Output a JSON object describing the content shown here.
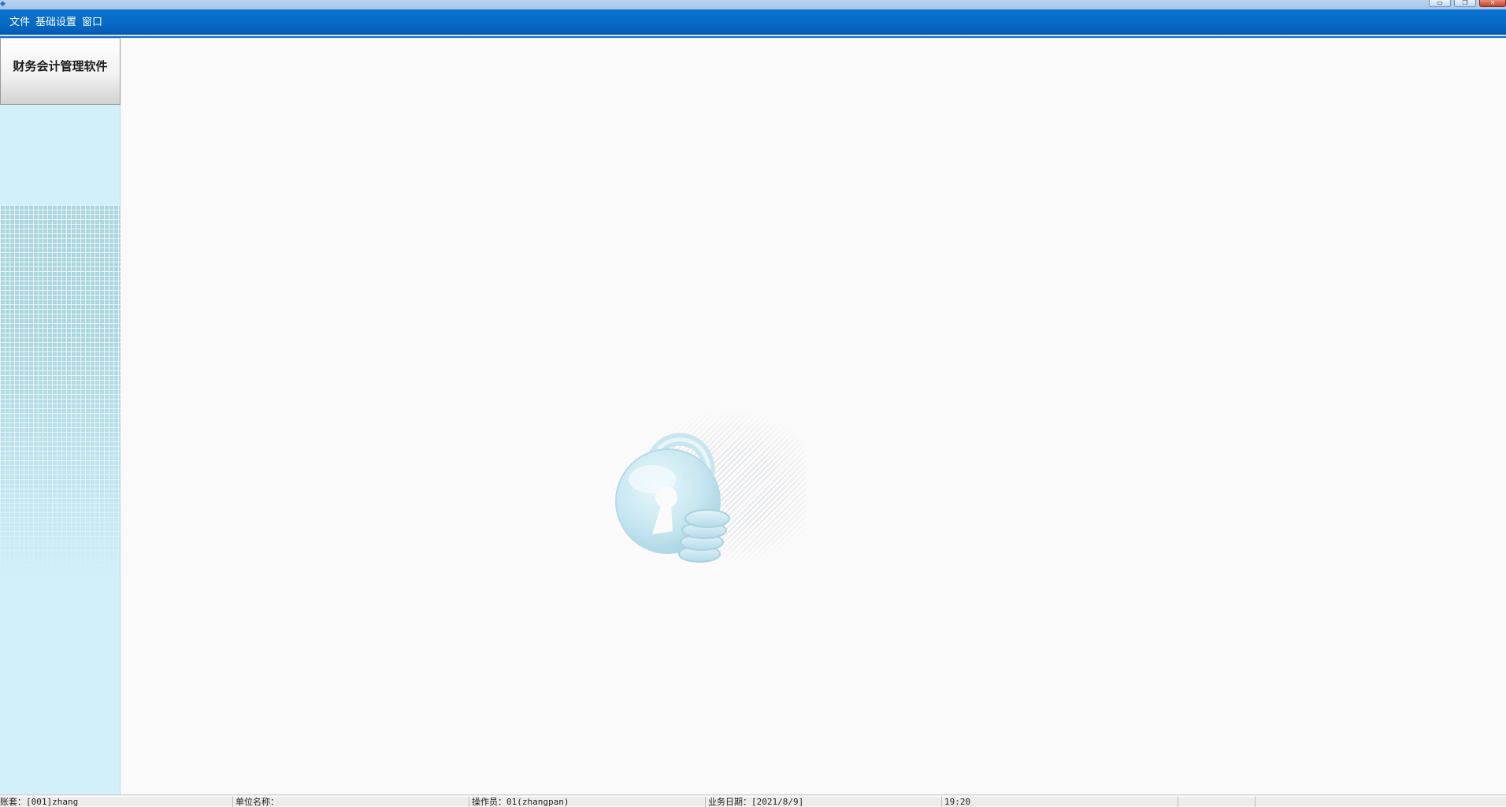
{
  "window": {
    "app_icon": "app-icon",
    "controls": {
      "minimize": "▭",
      "maximize": "❐",
      "close": "✕"
    }
  },
  "menu": {
    "items": [
      "文件",
      "基础设置",
      "窗口"
    ]
  },
  "sidebar": {
    "title": "财务会计管理软件"
  },
  "workspace": {
    "logo": "lock-with-coins-icon"
  },
  "status": {
    "account": "账套：[001]zhang",
    "unit": "单位名称：",
    "operator": "操作员：01(zhangpan)",
    "business_date": "业务日期：[2021/8/9]",
    "time": "19:20",
    "extra1": "",
    "extra2": ""
  },
  "colors": {
    "menubar": "#0568c4",
    "sidebar": "#d2f0f9",
    "workspace": "#fafafa",
    "logo": "#bfe3ee"
  }
}
